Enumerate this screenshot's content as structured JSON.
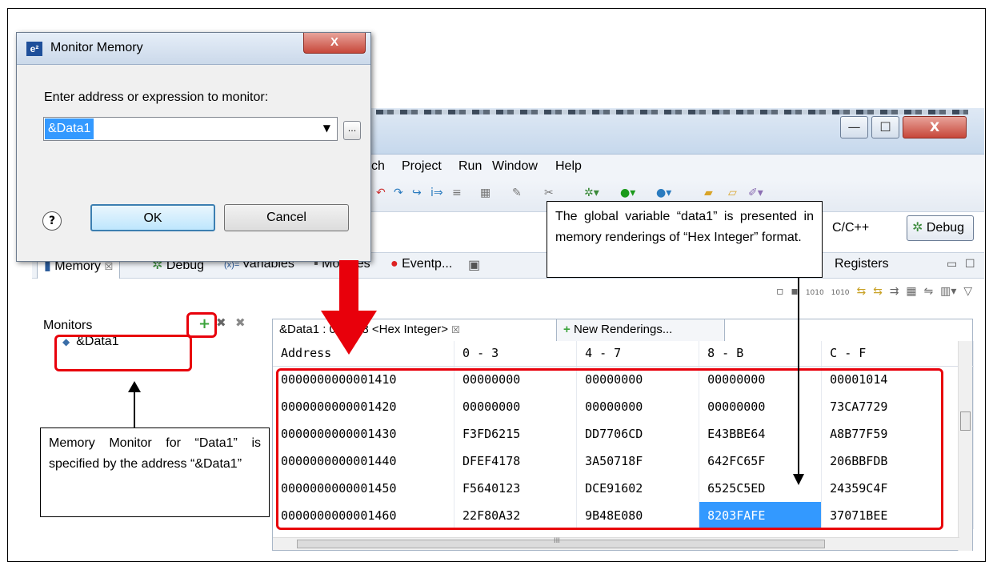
{
  "dialog": {
    "title": "Monitor Memory",
    "icon": "e²",
    "close_label": "X",
    "label": "Enter address or expression to monitor:",
    "value": "&Data1",
    "browse_label": "...",
    "help_label": "?",
    "ok_label": "OK",
    "cancel_label": "Cancel"
  },
  "window": {
    "min_label": "—",
    "max_label": "☐",
    "close_label": "X"
  },
  "menu": [
    "ch",
    "Project",
    "Run",
    "Window",
    "Help"
  ],
  "perspectives": {
    "cpp": "C/C++",
    "debug": "Debug"
  },
  "views": {
    "memory": "Memory",
    "debug": "Debug",
    "variables": "Variables",
    "modules": "Modules",
    "eventpoints": "Eventp...",
    "registers": "Registers"
  },
  "monitors": {
    "title": "Monitors",
    "items": [
      "&Data1"
    ]
  },
  "rendering": {
    "active_tab": "&Data1 : 0x1418 <Hex Integer>",
    "new_tab": "New Renderings...",
    "columns": [
      "Address",
      "0 - 3",
      "4 - 7",
      "8 - B",
      "C - F"
    ],
    "rows": [
      [
        "0000000000001410",
        "00000000",
        "00000000",
        "00000000",
        "00001014"
      ],
      [
        "0000000000001420",
        "00000000",
        "00000000",
        "00000000",
        "73CA7729"
      ],
      [
        "0000000000001430",
        "F3FD6215",
        "DD7706CD",
        "E43BBE64",
        "A8B77F59"
      ],
      [
        "0000000000001440",
        "DFEF4178",
        "3A50718F",
        "642FC65F",
        "206BBFDB"
      ],
      [
        "0000000000001450",
        "F5640123",
        "DCE91602",
        "6525C5ED",
        "24359C4F"
      ],
      [
        "0000000000001460",
        "22F80A32",
        "9B48E080",
        "8203FAFE",
        "37071BEE"
      ]
    ],
    "hscroll_label": "III"
  },
  "annotations": {
    "monitor_note": "Memory Monitor for “Data1” is specified by the address “&Data1”",
    "global_note": "The global variable “data1” is presented in memory renderings of “Hex Integer” format."
  },
  "colors": {
    "highlight": "#e8000b",
    "selection": "#3399ff"
  }
}
